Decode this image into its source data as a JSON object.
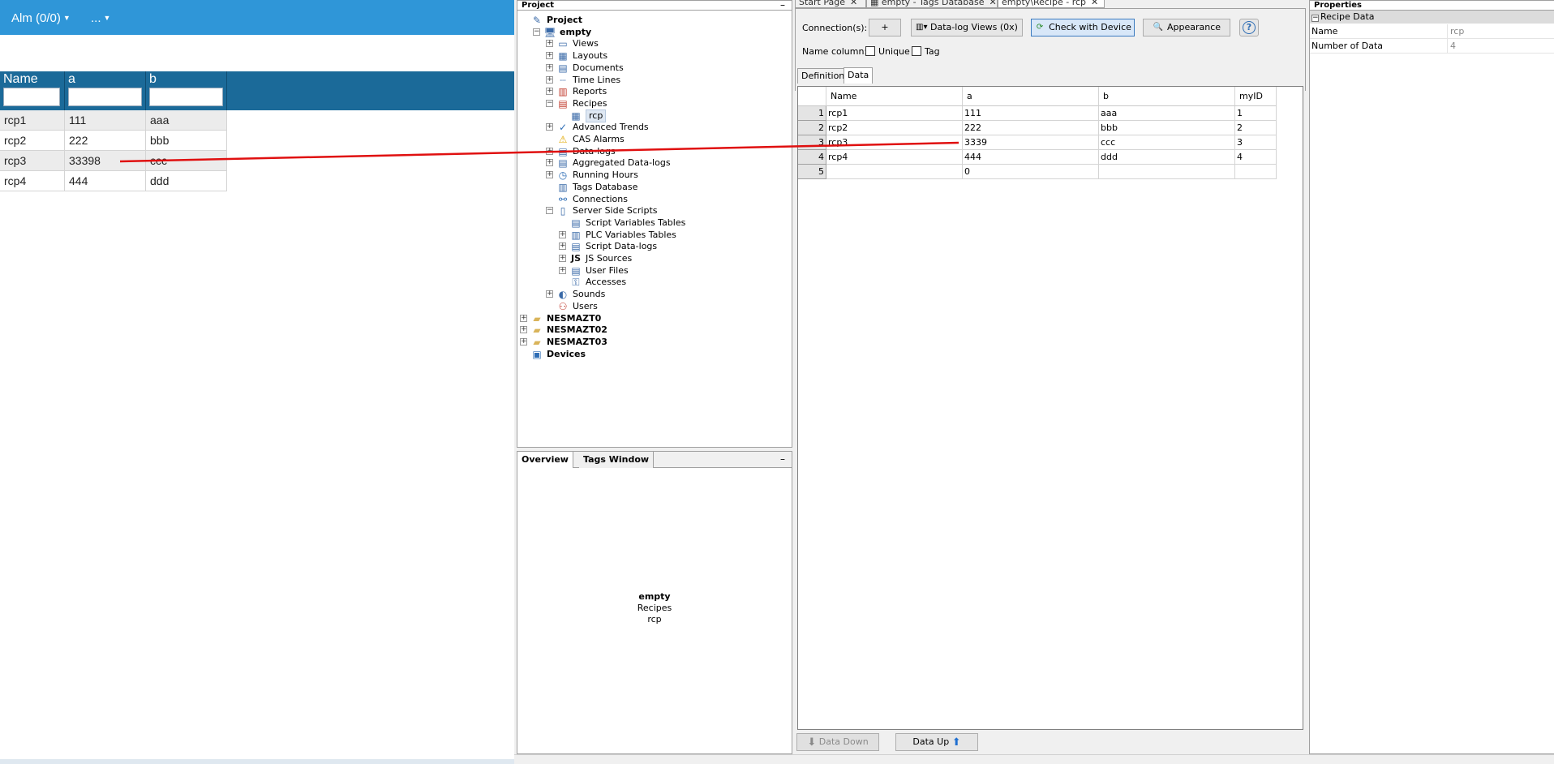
{
  "runtime": {
    "alarm_label": "Alm (0/0)",
    "more_label": "...",
    "table": {
      "columns": [
        "Name",
        "a",
        "b"
      ],
      "rows": [
        [
          "rcp1",
          "111",
          "aaa"
        ],
        [
          "rcp2",
          "222",
          "bbb"
        ],
        [
          "rcp3",
          "33398",
          "ccc"
        ],
        [
          "rcp4",
          "444",
          "ddd"
        ]
      ]
    }
  },
  "project_panel": {
    "title": "Project",
    "tree": [
      {
        "label": "Project",
        "icon": "project-icon",
        "bold": true
      },
      {
        "label": "empty",
        "icon": "computer-icon",
        "bold": true
      },
      {
        "label": "Views",
        "icon": "monitor-icon"
      },
      {
        "label": "Layouts",
        "icon": "grid-icon"
      },
      {
        "label": "Documents",
        "icon": "document-icon"
      },
      {
        "label": "Time Lines",
        "icon": "timeline-icon"
      },
      {
        "label": "Reports",
        "icon": "report-icon"
      },
      {
        "label": "Recipes",
        "icon": "recipe-icon"
      },
      {
        "label": "rcp",
        "icon": "table-icon",
        "selected": true
      },
      {
        "label": "Advanced Trends",
        "icon": "trend-icon"
      },
      {
        "label": "CAS Alarms",
        "icon": "alarm-bell-icon"
      },
      {
        "label": "Data-logs",
        "icon": "datalog-icon"
      },
      {
        "label": "Aggregated Data-logs",
        "icon": "aggregated-icon"
      },
      {
        "label": "Running Hours",
        "icon": "clock-icon"
      },
      {
        "label": "Tags Database",
        "icon": "database-icon"
      },
      {
        "label": "Connections",
        "icon": "connection-icon"
      },
      {
        "label": "Server Side Scripts",
        "icon": "server-icon"
      },
      {
        "label": "Script Variables Tables",
        "icon": "variables-icon"
      },
      {
        "label": "PLC Variables Tables",
        "icon": "plc-icon"
      },
      {
        "label": "Script Data-logs",
        "icon": "datalog-icon"
      },
      {
        "label": "JS Sources",
        "icon": "js-icon"
      },
      {
        "label": "User Files",
        "icon": "files-icon"
      },
      {
        "label": "Accesses",
        "icon": "key-icon"
      },
      {
        "label": "Sounds",
        "icon": "speaker-icon"
      },
      {
        "label": "Users",
        "icon": "users-icon"
      },
      {
        "label": "NESMAZT0",
        "icon": "folder-icon",
        "bold": true
      },
      {
        "label": "NESMAZT02",
        "icon": "folder-icon",
        "bold": true
      },
      {
        "label": "NESMAZT03",
        "icon": "folder-icon",
        "bold": true
      },
      {
        "label": "Devices",
        "icon": "devices-icon",
        "bold": true
      }
    ]
  },
  "overview_panel": {
    "tabs": [
      "Overview",
      "Tags Window"
    ],
    "info_title": "empty",
    "info_line1": "Recipes",
    "info_line2": "rcp"
  },
  "editor": {
    "tabs": [
      {
        "label": "Start Page"
      },
      {
        "label": "empty - Tags Database"
      },
      {
        "label": "empty\\Recipe - rcp",
        "active": true
      }
    ],
    "connections_label": "Connection(s):",
    "add_label": "+",
    "datalog_views_label": "Data-log Views (0x)",
    "check_device_label": "Check with Device",
    "appearance_label": "Appearance",
    "help_label": "?",
    "name_column_label": "Name column:",
    "unique_label": "Unique",
    "tag_label": "Tag",
    "subtabs": [
      "Definition",
      "Data"
    ],
    "grid": {
      "columns": [
        "Name",
        "a",
        "b",
        "myID"
      ],
      "rows": [
        [
          "1",
          "rcp1",
          "111",
          "aaa",
          "1"
        ],
        [
          "2",
          "rcp2",
          "222",
          "bbb",
          "2"
        ],
        [
          "3",
          "rcp3",
          "3339",
          "ccc",
          "3"
        ],
        [
          "4",
          "rcp4",
          "444",
          "ddd",
          "4"
        ],
        [
          "5",
          "",
          "0",
          "",
          ""
        ]
      ]
    },
    "data_down_label": "Data Down",
    "data_up_label": "Data Up"
  },
  "properties": {
    "title": "Properties",
    "category": "Recipe Data",
    "rows": [
      {
        "name": "Name",
        "value": "rcp"
      },
      {
        "name": "Number of Data",
        "value": "4"
      }
    ]
  },
  "colors": {
    "runtime_topbar": "#2f96d8",
    "runtime_header": "#1b6a99",
    "annotation_line": "#e01010"
  }
}
